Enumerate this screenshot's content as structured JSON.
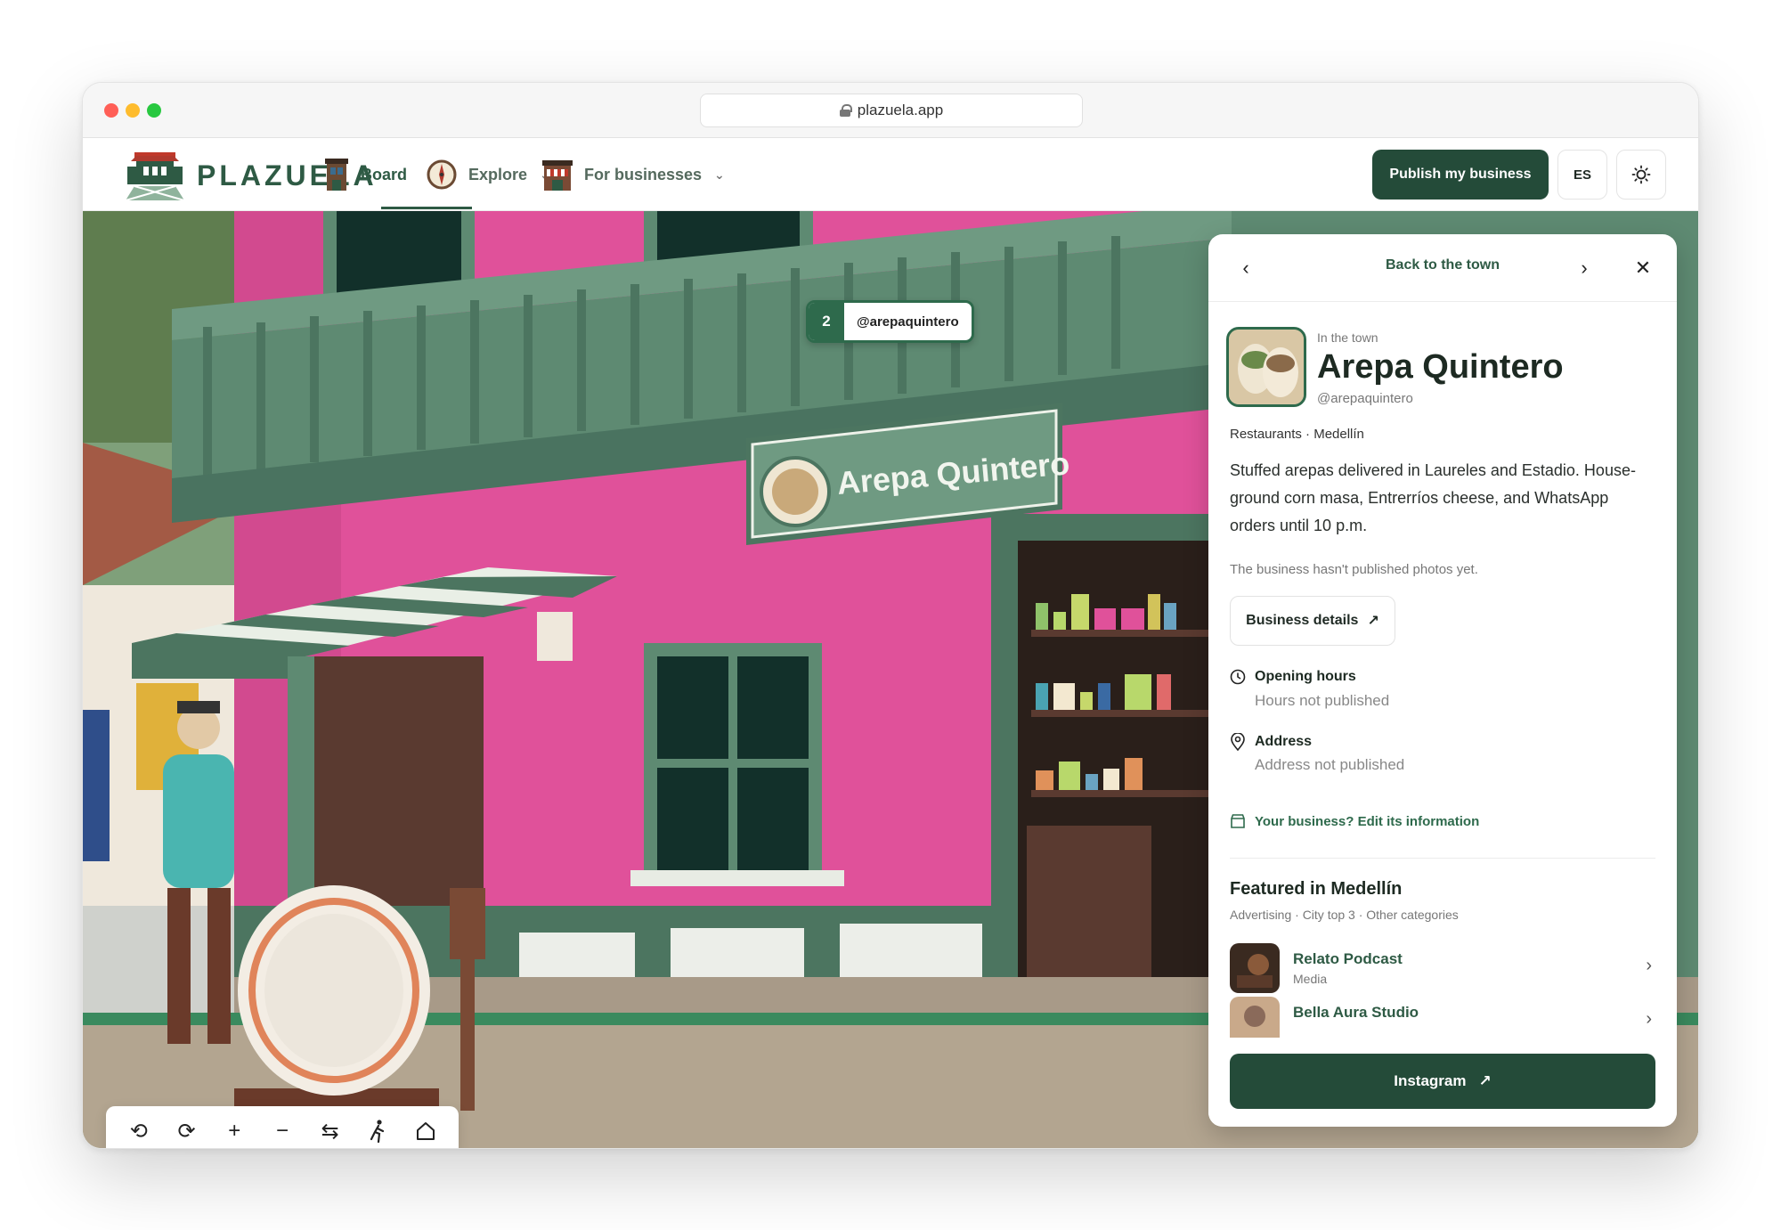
{
  "browser": {
    "url": "plazuela.app"
  },
  "header": {
    "logo_text": "PLAZUELA",
    "nav": {
      "board": "Board",
      "explore": "Explore",
      "for_businesses": "For businesses"
    },
    "publish_label": "Publish my business",
    "lang_label": "ES"
  },
  "scene": {
    "tag_number": "2",
    "tag_handle": "@arepaquintero",
    "sign_text": "Arepa Quintero"
  },
  "toolbar": {
    "tools": [
      "rotate-left-icon",
      "rotate-right-icon",
      "zoom-in-icon",
      "zoom-out-icon",
      "swap-icon",
      "walk-icon",
      "home-icon"
    ]
  },
  "panel": {
    "back_label": "Back to the town",
    "in_town": "In the town",
    "name": "Arepa Quintero",
    "handle": "@arepaquintero",
    "meta": "Restaurants · Medellín",
    "description": "Stuffed arepas delivered in Laureles and Estadio. House-ground corn masa, Entrerríos cheese, and WhatsApp orders until 10 p.m.",
    "no_photos": "The business hasn't published photos yet.",
    "details_label": "Business details",
    "hours_label": "Opening hours",
    "hours_value": "Hours not published",
    "address_label": "Address",
    "address_value": "Address not published",
    "edit_label": "Your business? Edit its information",
    "featured_title": "Featured in Medellín",
    "featured_meta": "Advertising · City top 3 · Other categories",
    "featured": [
      {
        "name": "Relato Podcast",
        "category": "Media"
      },
      {
        "name": "Bella Aura Studio",
        "category": ""
      }
    ],
    "instagram_label": "Instagram"
  },
  "colors": {
    "brand_green": "#244b39",
    "accent_green": "#2e6a4c",
    "wall_pink": "#e0519a"
  }
}
